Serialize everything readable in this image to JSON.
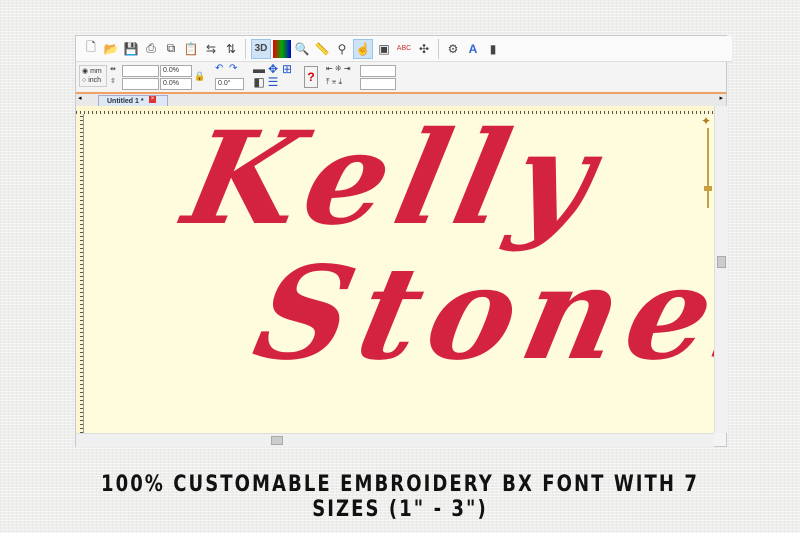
{
  "toolbar": {
    "icons": [
      "new-icon",
      "open-icon",
      "save-icon",
      "print-icon",
      "copy-icon",
      "paste-icon",
      "mirror-icon",
      "flip-icon",
      "3d-view-icon",
      "color-chart-icon",
      "zoom-icon",
      "measure-icon",
      "hoop-icon",
      "hand-select-icon",
      "background-icon",
      "text-abc-icon",
      "network-icon",
      "settings-icon",
      "font-a-icon",
      "stitch-icon"
    ],
    "label_3d": "3D"
  },
  "units": {
    "mm": "mm",
    "inch": "inch",
    "selected": "mm"
  },
  "size": {
    "width": "",
    "height": "",
    "width_pct": "0.0%",
    "height_pct": "0.0%",
    "rotation": "0.0°"
  },
  "tabs": [
    {
      "label": "Untitled 1 *"
    }
  ],
  "design": {
    "line1": "Kelly",
    "line2": "Stones",
    "color": "#d42340"
  },
  "caption": "100% CUSTOMABLE EMBROIDERY BX FONT WITH 7 SIZES (1\" -  3\")"
}
